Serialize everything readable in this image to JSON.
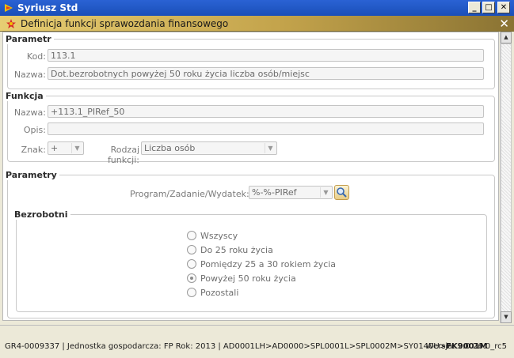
{
  "window": {
    "title": "Syriusz Std",
    "minimize": "_",
    "maximize": "□",
    "close": "✕"
  },
  "dialog": {
    "title": "Definicja funkcji sprawozdania finansowego",
    "close": "✕"
  },
  "parametr": {
    "legend": "Parametr",
    "kod_label": "Kod:",
    "kod_value": "113.1",
    "nazwa_label": "Nazwa:",
    "nazwa_value": "Dot.bezrobotnych powyżej 50 roku życia liczba osób/miejsc"
  },
  "funkcja": {
    "legend": "Funkcja",
    "nazwa_label": "Nazwa:",
    "nazwa_value": "+113.1_PIRef_50",
    "opis_label": "Opis:",
    "opis_value": "",
    "znak_label": "Znak:",
    "znak_value": "+",
    "rodzaj_label": "Rodzaj funkcji:",
    "rodzaj_value": "Liczba osób"
  },
  "parametry": {
    "legend": "Parametry",
    "program_label": "Program/Zadanie/Wydatek:",
    "program_value": "%-%-PIRef",
    "bezrobotni": {
      "legend": "Bezrobotni",
      "options": [
        {
          "label": "Wszyscy",
          "checked": false
        },
        {
          "label": "Do 25 roku życia",
          "checked": false
        },
        {
          "label": "Pomiędzy 25 a 30 rokiem życia",
          "checked": false
        },
        {
          "label": "Powyżej 50 roku życia",
          "checked": true
        },
        {
          "label": "Pozostali",
          "checked": false
        }
      ]
    }
  },
  "scrollbar": {
    "up": "▲",
    "down": "▼"
  },
  "status": {
    "path_prefix": "GR4-0009337 | Jednostka gospodarcza: FP Rok: 2013 | AD0001LH>AD0000>SPL0001L>SPL0002M>SY0140U>",
    "path_current": "FK9001M",
    "version": "Wersja: 2.0.26.0_rc5"
  },
  "icons": {
    "app": "app-logo-icon",
    "dialog": "dialog-star-icon",
    "search": "magnifier-icon",
    "arrow": "chevron-down-icon"
  },
  "colors": {
    "titlebar": "#1a4fb8",
    "subbar": "#c3a34b",
    "accent": "#e8cd86"
  }
}
